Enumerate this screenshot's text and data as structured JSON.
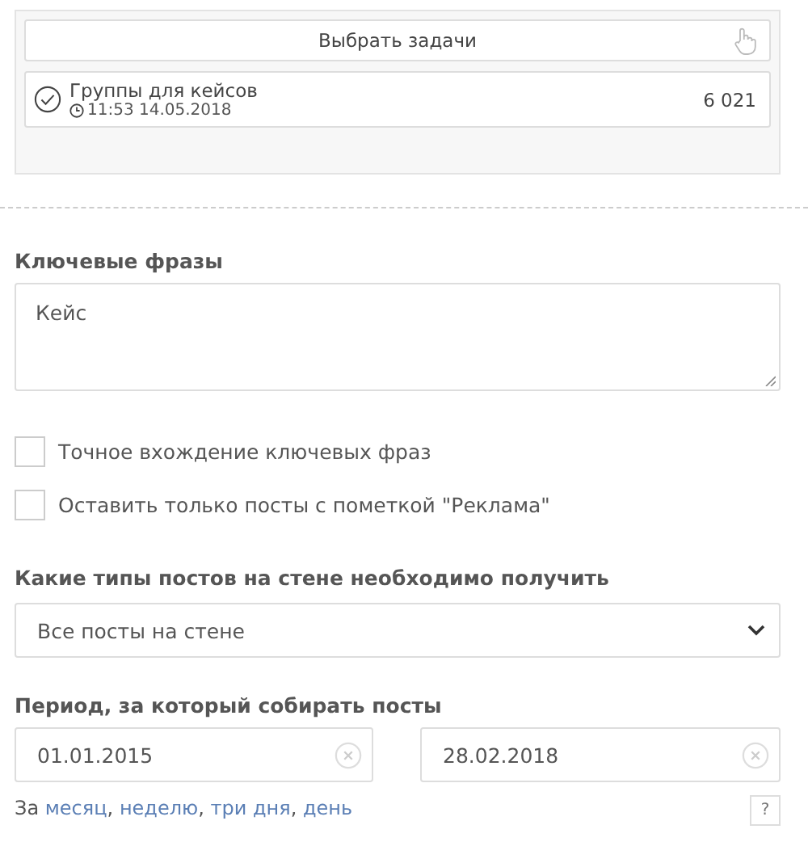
{
  "tasks_panel": {
    "select_button": "Выбрать задачи",
    "task": {
      "title": "Группы для кейсов",
      "time": "11:53 14.05.2018",
      "count": "6 021",
      "done": true
    }
  },
  "keywords": {
    "label": "Ключевые фразы",
    "value": "Кейс"
  },
  "options": [
    {
      "label": "Точное вхождение ключевых фраз",
      "checked": false
    },
    {
      "label": "Оставить только посты с пометкой \"Реклама\"",
      "checked": false
    }
  ],
  "post_types": {
    "label": "Какие типы постов на стене необходимо получить",
    "value": "Все посты на стене"
  },
  "period": {
    "label": "Период, за который собирать посты",
    "from": "01.01.2015",
    "to": "28.02.2018",
    "prefix": "За",
    "separator": ", ",
    "links": [
      "месяц",
      "неделю",
      "три дня",
      "день"
    ],
    "help": "?"
  }
}
